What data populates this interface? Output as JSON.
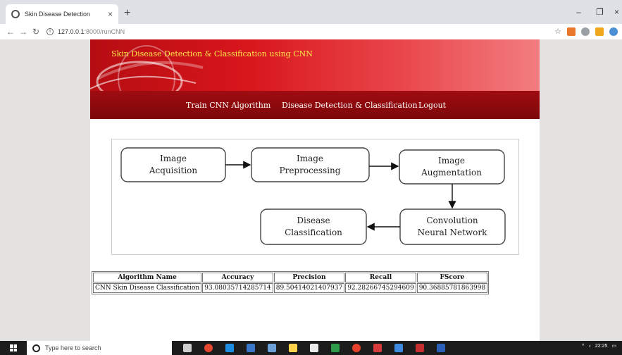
{
  "browser": {
    "tab_title": "Skin Disease Detection",
    "tab_close": "×",
    "new_tab": "+",
    "url_host": "127.0.0.1",
    "url_path": ":8000/runCNN",
    "minimize": "–",
    "maximize": "❐",
    "close": "×"
  },
  "site": {
    "title": "Skin Disease Detection & Classification using CNN",
    "nav": [
      "Train CNN Algorithm",
      "Disease Detection & Classification",
      "Logout"
    ]
  },
  "diagram": {
    "box1_line1": "Image",
    "box1_line2": "Acquisition",
    "box2_line1": "Image",
    "box2_line2": "Preprocessing",
    "box3_line1": "Image",
    "box3_line2": "Augmentation",
    "box4_line1": "Convolution",
    "box4_line2": "Neural Network",
    "box5_line1": "Disease",
    "box5_line2": "Classification"
  },
  "results": {
    "headers": [
      "Algorithm Name",
      "Accuracy",
      "Precision",
      "Recall",
      "FScore"
    ],
    "row": [
      "CNN Skin Disease Classification",
      "93.08035714285714",
      "89.50414021407937",
      "92.28266745294609",
      "90.36885781863998"
    ]
  },
  "taskbar": {
    "search_placeholder": "Type here to search",
    "time": "22:25"
  },
  "colors": {
    "banner_red": "#d8161c",
    "nav_dark_red": "#8a090c",
    "title_yellow": "#ffe94a"
  }
}
